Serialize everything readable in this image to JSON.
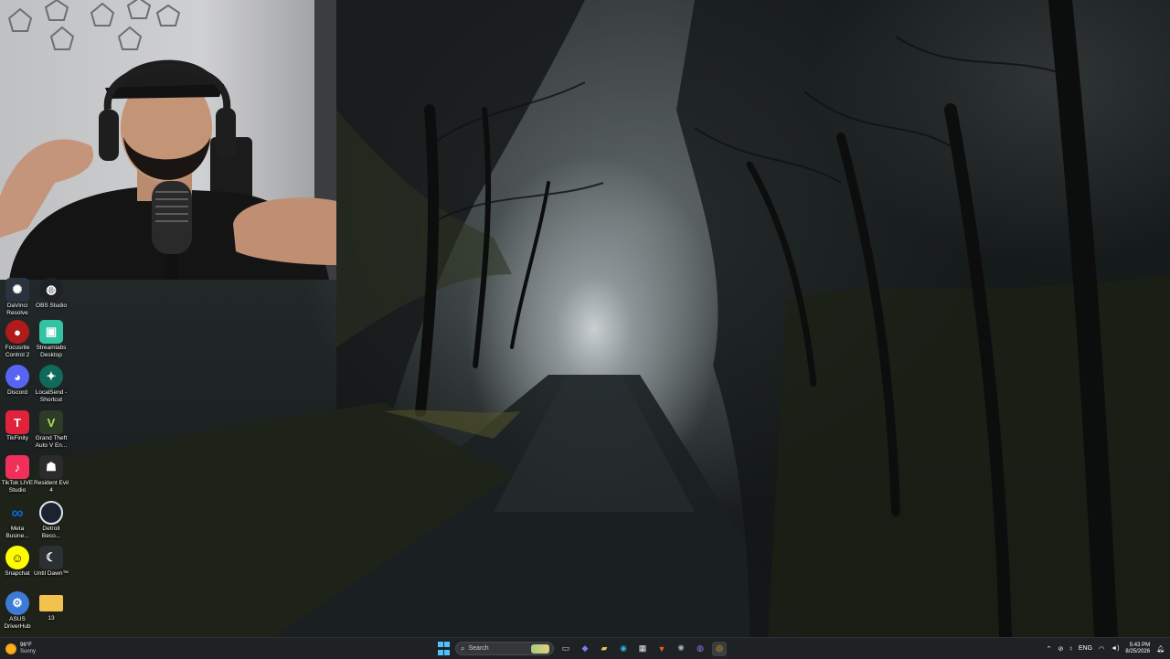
{
  "desktop": {
    "icons": [
      {
        "label": "DaVinci Resolve",
        "icon": "davinci-resolve-icon",
        "color": "#2a3340"
      },
      {
        "label": "OBS Studio",
        "icon": "obs-studio-icon",
        "color": "#1e2226"
      },
      {
        "label": "Focusrite Control 2",
        "icon": "focusrite-icon",
        "color": "#b11a1a"
      },
      {
        "label": "Streamlabs Desktop",
        "icon": "streamlabs-icon",
        "color": "#31c3a2"
      },
      {
        "label": "Discord",
        "icon": "discord-icon",
        "color": "#5865f2"
      },
      {
        "label": "LocalSend - Shortcut",
        "icon": "localsend-icon",
        "color": "#0f6a5a"
      },
      {
        "label": "TikFinity",
        "icon": "tikfinity-icon",
        "color": "#e0223a"
      },
      {
        "label": "Grand Theft Auto V En...",
        "icon": "gta-v-icon",
        "color": "#2e3b26"
      },
      {
        "label": "TikTok LIVE Studio",
        "icon": "tiktok-live-icon",
        "color": "#f0305a"
      },
      {
        "label": "Resident Evil 4",
        "icon": "resident-evil-icon",
        "color": "#2b2b2b"
      },
      {
        "label": "Meta Busine...",
        "icon": "meta-business-icon",
        "color": "#0a66e4"
      },
      {
        "label": "Detroit Beco...",
        "icon": "detroit-icon",
        "color": "#1b2230"
      },
      {
        "label": "Snapchat",
        "icon": "snapchat-icon",
        "color": "#fffc00"
      },
      {
        "label": "Until Dawn™",
        "icon": "until-dawn-icon",
        "color": "#2a3034"
      },
      {
        "label": "ASUS DriverHub",
        "icon": "asus-driverhub-icon",
        "color": "#3b7bd6"
      },
      {
        "label": "13",
        "icon": "folder-icon",
        "color": "#f2c14e"
      }
    ]
  },
  "taskbar": {
    "weather": {
      "temp": "96°F",
      "condition": "Sunny",
      "icon": "sun-icon"
    },
    "search_placeholder": "Search",
    "pinned": [
      {
        "name": "task-view-icon",
        "glyph": "▭",
        "color": "#cfd3d6"
      },
      {
        "name": "copilot-icon",
        "glyph": "◆",
        "color": "#7c7cf5"
      },
      {
        "name": "file-explorer-icon",
        "glyph": "▰",
        "color": "#f2c14e"
      },
      {
        "name": "edge-icon",
        "glyph": "◉",
        "color": "#2fb0e8"
      },
      {
        "name": "microsoft-store-icon",
        "glyph": "▦",
        "color": "#e9eaeb"
      },
      {
        "name": "brave-icon",
        "glyph": "▼",
        "color": "#f05a24"
      },
      {
        "name": "davinci-taskbar-icon",
        "glyph": "✺",
        "color": "#9fb2c4"
      },
      {
        "name": "obs-taskbar-icon",
        "glyph": "◍",
        "color": "#8d7cf5"
      },
      {
        "name": "chrome-icon",
        "glyph": "◎",
        "color": "#f4b400"
      }
    ],
    "tray": {
      "language": "ENG",
      "time": "5:43 PM",
      "date": "8/25/2026"
    }
  }
}
